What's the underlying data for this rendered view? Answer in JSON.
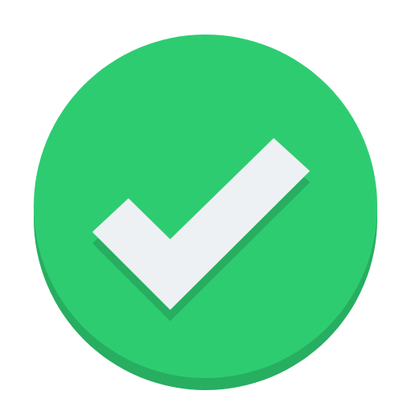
{
  "icon": {
    "name": "checkmark-circle-icon",
    "colors": {
      "circle": "#2ecc71",
      "circle_shadow": "#27ae60",
      "check": "#eef1f4",
      "check_shadow": "#27ae60"
    }
  }
}
